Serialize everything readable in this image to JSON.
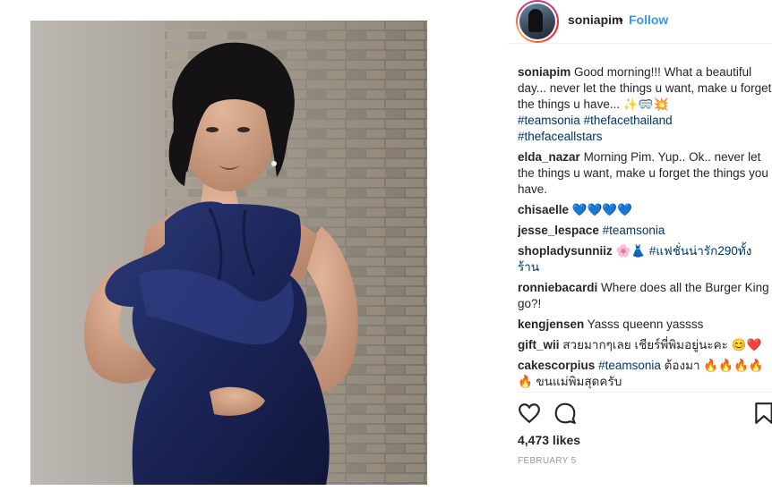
{
  "post": {
    "username": "soniapim",
    "follow_label": "Follow",
    "dot": "•",
    "likes": "4,473 likes",
    "date": "FEBRUARY 5"
  },
  "comments": [
    {
      "user": "soniapim",
      "text": "Good morning!!! What a beautiful day... never let the things u want, make u forget the things u have...",
      "emoji": "✨🥽💥",
      "tags": [
        "#teamsonia",
        "#thefacethailand",
        "#thefaceallstars"
      ]
    },
    {
      "user": "elda_nazar",
      "text": "Morning Pim. Yup.. Ok.. never let the things u want, make u forget the things you have."
    },
    {
      "user": "chisaelle",
      "text": "",
      "emoji": "💙💙💙💙"
    },
    {
      "user": "jesse_lespace",
      "text": "",
      "tags": [
        "#teamsonia"
      ]
    },
    {
      "user": "shopladysunniiz",
      "text": "",
      "emoji": "🌸👗",
      "tags": [
        "#แฟชั่นน่ารัก290ทั้งร้าน"
      ]
    },
    {
      "user": "ronniebacardi",
      "text": "Where does all the Burger King go?!"
    },
    {
      "user": "kengjensen",
      "text": "Yasss queenn yassss"
    },
    {
      "user": "gift_wii",
      "text": "สวยมากๆเลย เชียร์พี่พิมอยู่นะคะ",
      "emoji": "😊❤️"
    },
    {
      "user": "cakescorpius",
      "text": "ต้องมา",
      "emoji": "🔥🔥🔥🔥",
      "tags": [
        "#teamsonia"
      ],
      "extra": "🔥 ขนแม่พิมสุดครับ"
    }
  ],
  "icons": {
    "like": "heart-icon",
    "comment": "comment-bubble-icon",
    "save": "bookmark-icon"
  }
}
